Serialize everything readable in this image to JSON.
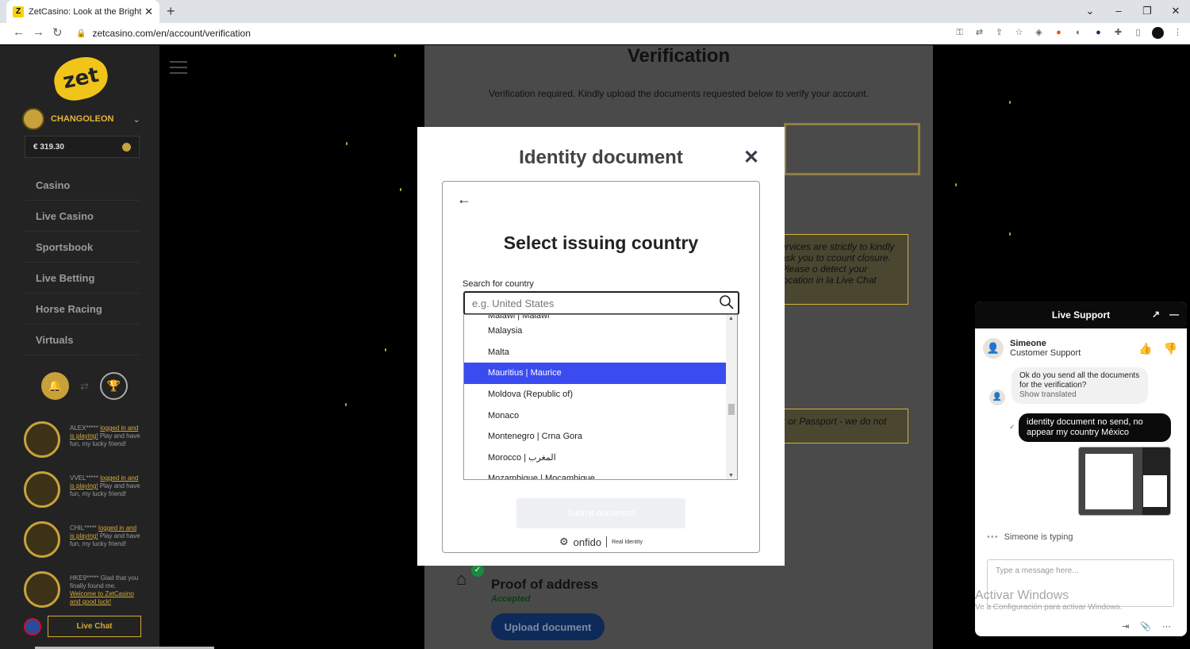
{
  "browser": {
    "tab_title": "ZetCasino: Look at the Bright Sid",
    "favicon_letter": "Z",
    "url": "zetcasino.com/en/account/verification"
  },
  "sidebar": {
    "username": "CHANGOLEON",
    "balance": "€ 319.30",
    "menu": [
      "Casino",
      "Live Casino",
      "Sportsbook",
      "Live Betting",
      "Horse Racing",
      "Virtuals"
    ],
    "feed": [
      {
        "user": "ALEX*****",
        "link": "logged in and is playing!",
        "text": "Play and have fun, my lucky friend!"
      },
      {
        "user": "VVEL*****",
        "link": "logged in and is playing!",
        "text": "Play and have fun, my lucky friend!"
      },
      {
        "user": "CHIL*****",
        "link": "logged in and is playing!",
        "text": "Play and have fun, my lucky friend!"
      },
      {
        "user": "HKE9*****",
        "text": "Glad that you finally found me.",
        "link": "Welcome to ZetCasino and good luck!"
      }
    ],
    "live_chat_label": "Live Chat"
  },
  "verification": {
    "title": "Verification",
    "subtitle": "Verification required. Kindly upload the documents requested below to verify your account.",
    "info1": "ervices are strictly to kindly ask you to ccount closure. Please o detect your location in la Live Chat",
    "info2": "k or Passport - we do not",
    "proof_title": "Proof of address",
    "proof_status": "Accepted",
    "upload_label": "Upload document"
  },
  "modal": {
    "title": "Identity document",
    "close_glyph": "✕",
    "select_title": "Select issuing country",
    "search_label": "Search for country",
    "search_placeholder": "e.g. United States",
    "countries_top_partial": "Malawi | Malawi",
    "countries": [
      "Malaysia",
      "Malta",
      "Mauritius | Maurice",
      "Moldova (Republic of)",
      "Monaco",
      "Montenegro | Crna Gora",
      "Morocco | المغرب"
    ],
    "countries_bottom_partial": "Mozambique | Moçambique",
    "selected_country": "Mauritius | Maurice",
    "submit_label": "Submit document",
    "brand": "onfido",
    "brand_tag": "Real Identity"
  },
  "support": {
    "title": "Live Support",
    "agent_name": "Simeone",
    "agent_role": "Customer Support",
    "agent_message": "Ok do you send all the documents for the verification?",
    "show_translated": "Show translated",
    "user_message": "identity document no send, no appear my country México",
    "typing": "Simeone is typing",
    "input_placeholder": "Type a message here..."
  },
  "windows_watermark": {
    "line1": "Activar Windows",
    "line2": "Ve a Configuración para activar Windows."
  },
  "colors": {
    "accent_gold": "#d6a935",
    "selected_blue": "#3a4cf0"
  }
}
